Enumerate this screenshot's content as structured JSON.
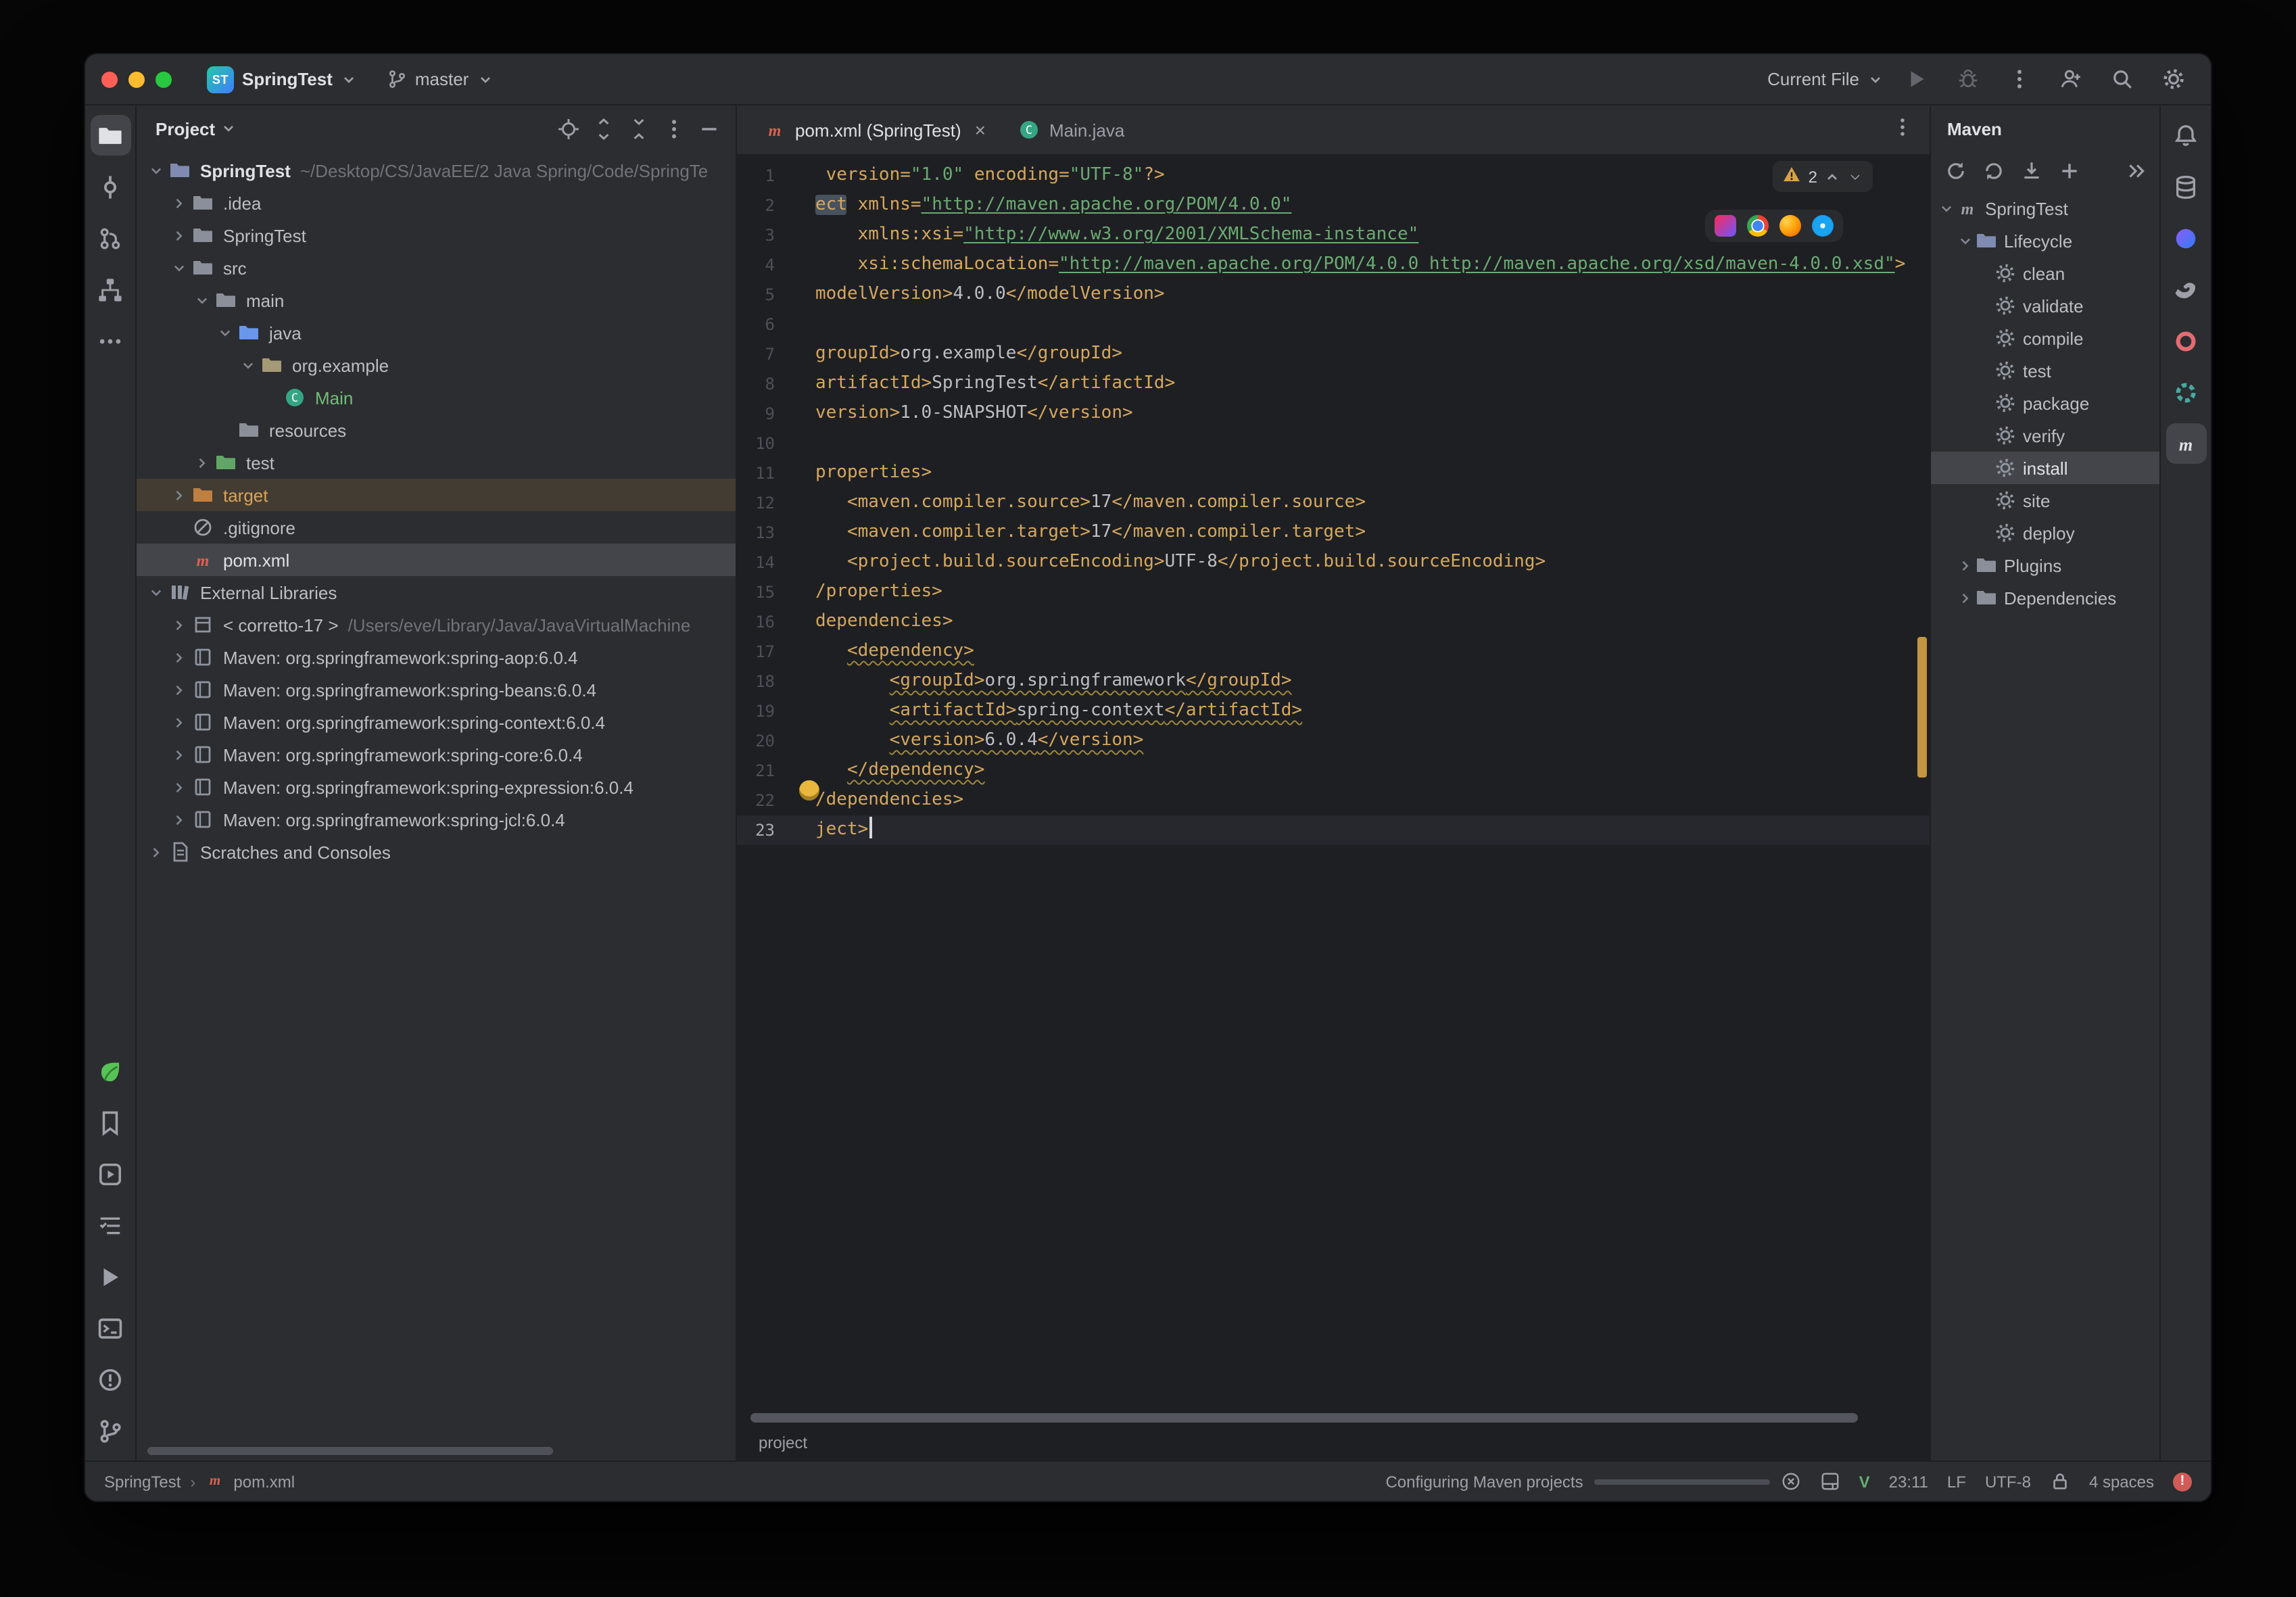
{
  "titlebar": {
    "project_abbrev": "ST",
    "project_name": "SpringTest",
    "branch": "master",
    "run_config": "Current File"
  },
  "left_toolbar": {
    "top": [
      {
        "name": "project",
        "active": true
      },
      {
        "name": "commit"
      },
      {
        "name": "pull-requests"
      },
      {
        "name": "structure"
      },
      {
        "name": "more"
      }
    ],
    "bottom": [
      {
        "name": "plugin"
      },
      {
        "name": "bookmarks"
      },
      {
        "name": "services"
      },
      {
        "name": "todo"
      },
      {
        "name": "run"
      },
      {
        "name": "terminal"
      },
      {
        "name": "problems"
      },
      {
        "name": "version-control"
      }
    ]
  },
  "right_toolbar": {
    "top": [
      {
        "name": "notifications"
      },
      {
        "name": "database"
      },
      {
        "name": "ai-assistant"
      },
      {
        "name": "gradle"
      },
      {
        "name": "profiler"
      },
      {
        "name": "endpoints"
      },
      {
        "name": "maven-tool",
        "active": true
      }
    ]
  },
  "project_panel": {
    "title": "Project",
    "toolbar": [
      "locate",
      "expand-all",
      "collapse-all",
      "kebab",
      "minimize"
    ],
    "tree": [
      {
        "indent": 0,
        "chevron": "down",
        "icon": "project-folder",
        "label": "SpringTest",
        "suffix": "~/Desktop/CS/JavaEE/2 Java Spring/Code/SpringTe",
        "bold": true
      },
      {
        "indent": 1,
        "chevron": "right",
        "icon": "folder",
        "label": ".idea"
      },
      {
        "indent": 1,
        "chevron": "right",
        "icon": "folder",
        "label": "SpringTest"
      },
      {
        "indent": 1,
        "chevron": "down",
        "icon": "folder",
        "label": "src"
      },
      {
        "indent": 2,
        "chevron": "down",
        "icon": "folder",
        "label": "main"
      },
      {
        "indent": 3,
        "chevron": "down",
        "icon": "folder-source",
        "label": "java"
      },
      {
        "indent": 4,
        "chevron": "down",
        "icon": "package",
        "label": "org.example"
      },
      {
        "indent": 5,
        "chevron": "none",
        "icon": "class",
        "label": "Main",
        "added": true
      },
      {
        "indent": 3,
        "chevron": "none",
        "icon": "folder-resources",
        "label": "resources"
      },
      {
        "indent": 2,
        "chevron": "right",
        "icon": "folder-test",
        "label": "test"
      },
      {
        "indent": 1,
        "chevron": "right",
        "icon": "folder-excluded",
        "label": "target",
        "row": "target"
      },
      {
        "indent": 1,
        "chevron": "none",
        "icon": "gitignore",
        "label": ".gitignore"
      },
      {
        "indent": 1,
        "chevron": "none",
        "icon": "maven-file",
        "label": "pom.xml",
        "row": "selected"
      },
      {
        "indent": 0,
        "chevron": "down",
        "icon": "libraries",
        "label": "External Libraries"
      },
      {
        "indent": 1,
        "chevron": "right",
        "icon": "jdk",
        "label": "< corretto-17 >",
        "suffix": "/Users/eve/Library/Java/JavaVirtualMachine"
      },
      {
        "indent": 1,
        "chevron": "right",
        "icon": "library",
        "label": "Maven: org.springframework:spring-aop:6.0.4"
      },
      {
        "indent": 1,
        "chevron": "right",
        "icon": "library",
        "label": "Maven: org.springframework:spring-beans:6.0.4"
      },
      {
        "indent": 1,
        "chevron": "right",
        "icon": "library",
        "label": "Maven: org.springframework:spring-context:6.0.4"
      },
      {
        "indent": 1,
        "chevron": "right",
        "icon": "library",
        "label": "Maven: org.springframework:spring-core:6.0.4"
      },
      {
        "indent": 1,
        "chevron": "right",
        "icon": "library",
        "label": "Maven: org.springframework:spring-expression:6.0.4"
      },
      {
        "indent": 1,
        "chevron": "right",
        "icon": "library",
        "label": "Maven: org.springframework:spring-jcl:6.0.4"
      },
      {
        "indent": 0,
        "chevron": "right",
        "icon": "scratches",
        "label": "Scratches and Consoles"
      }
    ]
  },
  "editor": {
    "tabs": [
      {
        "label": "pom.xml (SpringTest)",
        "icon": "maven-file",
        "active": true,
        "closable": true
      },
      {
        "label": "Main.java",
        "icon": "class",
        "active": false,
        "closable": false
      }
    ],
    "inspection_warnings": "2",
    "breadcrumb": "project",
    "lines": [
      {
        "n": 1,
        "seg": [
          [
            " version=",
            "tag"
          ],
          [
            "\"1.0\"",
            "str"
          ],
          [
            " encoding=",
            "tag"
          ],
          [
            "\"UTF-8\"",
            "str"
          ],
          [
            "?>",
            "tag"
          ]
        ]
      },
      {
        "n": 2,
        "seg": [
          [
            "ect",
            "tag hl"
          ],
          [
            " xmlns=",
            "tag"
          ],
          [
            "\"http://maven.apache.org/POM/4.0.0\"",
            "link"
          ]
        ]
      },
      {
        "n": 3,
        "seg": [
          [
            "    xmlns:xsi=",
            "tag"
          ],
          [
            "\"http://www.w3.org/2001/XMLSchema-instance\"",
            "link"
          ]
        ]
      },
      {
        "n": 4,
        "seg": [
          [
            "    xsi:schemaLocation=",
            "tag"
          ],
          [
            "\"http://maven.apache.org/POM/4.0.0 http://maven.apache.org/xsd/maven-4.0.0.xsd\"",
            "link"
          ],
          [
            ">",
            "tag"
          ]
        ]
      },
      {
        "n": 5,
        "seg": [
          [
            "modelVersion>",
            "tag"
          ],
          [
            "4.0.0",
            "plain"
          ],
          [
            "</modelVersion>",
            "tag"
          ]
        ]
      },
      {
        "n": 6,
        "seg": []
      },
      {
        "n": 7,
        "seg": [
          [
            "groupId>",
            "tag"
          ],
          [
            "org.example",
            "plain"
          ],
          [
            "</groupId>",
            "tag"
          ]
        ]
      },
      {
        "n": 8,
        "seg": [
          [
            "artifactId>",
            "tag"
          ],
          [
            "SpringTest",
            "plain"
          ],
          [
            "</artifactId>",
            "tag"
          ]
        ]
      },
      {
        "n": 9,
        "seg": [
          [
            "version>",
            "tag"
          ],
          [
            "1.0-SNAPSHOT",
            "plain"
          ],
          [
            "</version>",
            "tag"
          ]
        ]
      },
      {
        "n": 10,
        "seg": []
      },
      {
        "n": 11,
        "seg": [
          [
            "properties>",
            "tag"
          ]
        ]
      },
      {
        "n": 12,
        "seg": [
          [
            "   ",
            "plain"
          ],
          [
            "<maven.compiler.source>",
            "tag"
          ],
          [
            "17",
            "plain"
          ],
          [
            "</maven.compiler.source>",
            "tag"
          ]
        ]
      },
      {
        "n": 13,
        "seg": [
          [
            "   ",
            "plain"
          ],
          [
            "<maven.compiler.target>",
            "tag"
          ],
          [
            "17",
            "plain"
          ],
          [
            "</maven.compiler.target>",
            "tag"
          ]
        ]
      },
      {
        "n": 14,
        "seg": [
          [
            "   ",
            "plain"
          ],
          [
            "<project.build.sourceEncoding>",
            "tag"
          ],
          [
            "UTF-8",
            "plain"
          ],
          [
            "</project.build.sourceEncoding>",
            "tag"
          ]
        ]
      },
      {
        "n": 15,
        "seg": [
          [
            "/properties>",
            "tag"
          ]
        ]
      },
      {
        "n": 16,
        "seg": [
          [
            "dependencies>",
            "tag"
          ]
        ]
      },
      {
        "n": 17,
        "seg": [
          [
            "   ",
            "plain"
          ],
          [
            "<dependency>",
            "tag wavy"
          ]
        ]
      },
      {
        "n": 18,
        "seg": [
          [
            "       ",
            "plain"
          ],
          [
            "<groupId>",
            "tag wavy"
          ],
          [
            "org.springframework",
            "plain wavy"
          ],
          [
            "</groupId>",
            "tag wavy"
          ]
        ]
      },
      {
        "n": 19,
        "seg": [
          [
            "       ",
            "plain"
          ],
          [
            "<artifactId>",
            "tag wavy"
          ],
          [
            "spring-context",
            "plain wavy"
          ],
          [
            "</artifactId>",
            "tag wavy"
          ]
        ]
      },
      {
        "n": 20,
        "seg": [
          [
            "       ",
            "plain"
          ],
          [
            "<version>",
            "tag wavy"
          ],
          [
            "6.0.4",
            "plain wavy"
          ],
          [
            "</version>",
            "tag wavy"
          ]
        ]
      },
      {
        "n": 21,
        "seg": [
          [
            "   ",
            "plain"
          ],
          [
            "</dependency>",
            "tag wavy"
          ]
        ]
      },
      {
        "n": 22,
        "seg": [
          [
            "/dependencies>",
            "tag"
          ]
        ]
      },
      {
        "n": 23,
        "seg": [
          [
            "ject>",
            "tag"
          ]
        ],
        "current": true,
        "caret": true
      }
    ]
  },
  "maven_panel": {
    "title": "Maven",
    "toolbar": [
      "refresh",
      "reimport",
      "download-sources",
      "add"
    ],
    "toolbar_right": [
      "chevron-double"
    ],
    "tree": [
      {
        "indent": 0,
        "chevron": "down",
        "icon": "maven-root",
        "label": "SpringTest"
      },
      {
        "indent": 1,
        "chevron": "down",
        "icon": "lifecycle",
        "label": "Lifecycle"
      },
      {
        "indent": 2,
        "chevron": "none",
        "icon": "goal",
        "label": "clean"
      },
      {
        "indent": 2,
        "chevron": "none",
        "icon": "goal",
        "label": "validate"
      },
      {
        "indent": 2,
        "chevron": "none",
        "icon": "goal",
        "label": "compile"
      },
      {
        "indent": 2,
        "chevron": "none",
        "icon": "goal",
        "label": "test"
      },
      {
        "indent": 2,
        "chevron": "none",
        "icon": "goal",
        "label": "package"
      },
      {
        "indent": 2,
        "chevron": "none",
        "icon": "goal",
        "label": "verify"
      },
      {
        "indent": 2,
        "chevron": "none",
        "icon": "goal",
        "label": "install",
        "row": "selected"
      },
      {
        "indent": 2,
        "chevron": "none",
        "icon": "goal",
        "label": "site"
      },
      {
        "indent": 2,
        "chevron": "none",
        "icon": "goal",
        "label": "deploy"
      },
      {
        "indent": 1,
        "chevron": "right",
        "icon": "plugins",
        "label": "Plugins"
      },
      {
        "indent": 1,
        "chevron": "right",
        "icon": "dependencies",
        "label": "Dependencies"
      }
    ]
  },
  "status_bar": {
    "project_crumb": "SpringTest",
    "file_crumb": "pom.xml",
    "progress_label": "Configuring Maven projects",
    "progress_percent": 88,
    "vim_indicator": "V",
    "caret_position": "23:11",
    "line_separator": "LF",
    "encoding": "UTF-8",
    "indent_style": "4 spaces"
  }
}
